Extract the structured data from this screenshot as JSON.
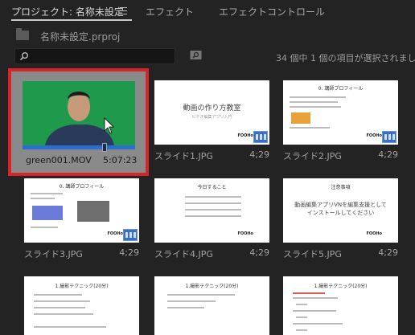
{
  "tabs": {
    "project": "プロジェクト: 名称未設定",
    "effects": "エフェクト",
    "effect_controls": "エフェクトコントロール"
  },
  "project_file": "名称未設定.prproj",
  "search": {
    "value": ""
  },
  "status_text": "34 個中 1 個の項目が選択されました",
  "colors": {
    "selection_border": "#d9232b",
    "green_screen": "#1f9a4c",
    "badge": "#3a6fc4"
  },
  "items": [
    {
      "name": "green001.MOV",
      "duration": "5:07:23",
      "selected": true,
      "playhead_fraction": 0.8
    },
    {
      "name": "スライド1.JPG",
      "duration": "4;29",
      "slide_title": "動画の作り方教室",
      "slide_subtitle": "ビデオ編集アプリ入門"
    },
    {
      "name": "スライド2.JPG",
      "duration": "4;29",
      "slide_title": "0. 講師プロフィール",
      "slide_subtitle": ""
    },
    {
      "name": "スライド3.JPG",
      "duration": "4;29",
      "slide_title": "0. 講師プロフィール",
      "slide_subtitle": ""
    },
    {
      "name": "スライド4.JPG",
      "duration": "4;29",
      "slide_title": "今日すること",
      "slide_subtitle": ""
    },
    {
      "name": "スライド5.JPG",
      "duration": "4;29",
      "slide_title": "注意事項",
      "slide_subtitle": "動画編集アプリVNを編集支援として インストールしてください"
    },
    {
      "name": "",
      "duration": "",
      "slide_title": "1.撮影テクニック(20分)",
      "slide_subtitle": ""
    },
    {
      "name": "",
      "duration": "",
      "slide_title": "1.撮影テクニック(20分)",
      "slide_subtitle": ""
    },
    {
      "name": "",
      "duration": "",
      "slide_title": "1.撮影テクニック(20分)",
      "slide_subtitle": ""
    }
  ],
  "thumb_logo": "FOOHo"
}
